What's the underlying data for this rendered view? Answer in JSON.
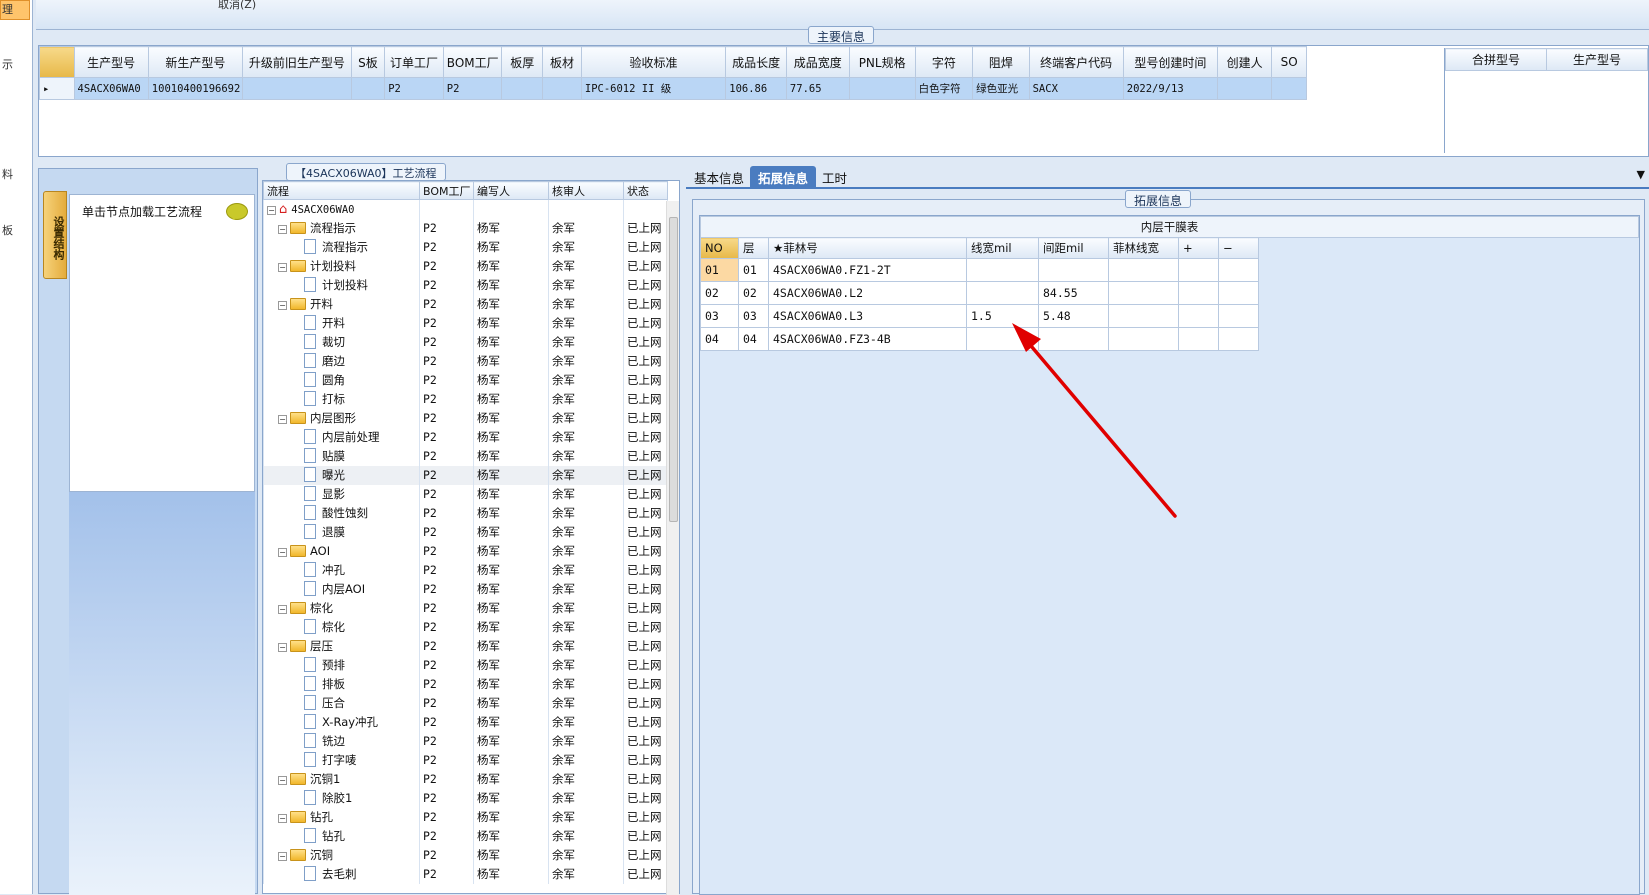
{
  "app": {
    "left_strip": {
      "items": [
        "理",
        "示",
        "料",
        "板"
      ]
    },
    "top_bar": {
      "cancel_label": "取消(Z)"
    }
  },
  "main_info": {
    "title": "主要信息",
    "columns": [
      "生产型号",
      "新生产型号",
      "升级前旧生产型号",
      "S板",
      "订单工厂",
      "BOM工厂",
      "板厚",
      "板材",
      "验收标准",
      "成品长度",
      "成品宽度",
      "PNL规格",
      "字符",
      "阻焊",
      "终端客户代码",
      "型号创建时间",
      "创建人",
      "SO"
    ],
    "row": [
      "4SACX06WA0",
      "10010400196692",
      "",
      "",
      "P2",
      "P2",
      "",
      "",
      "IPC-6012 II 级",
      "106.86",
      "77.65",
      "",
      "白色字符",
      "绿色亚光",
      "SACX",
      "2022/9/13",
      "",
      ""
    ],
    "side_columns": [
      "合拼型号",
      "生产型号"
    ]
  },
  "process_panel": {
    "title": "【4SACX06WA0】工艺流程",
    "vertical_tab": "设置结构",
    "load_hint": "单击节点加载工艺流程",
    "columns": [
      "流程",
      "BOM工厂",
      "编写人",
      "核审人",
      "状态"
    ],
    "root": "4SACX06WA0",
    "rows": [
      {
        "level": 1,
        "label": "流程指示",
        "factory": "P2",
        "writer": "杨军",
        "reviewer": "余军",
        "status": "已上网"
      },
      {
        "level": 2,
        "label": "流程指示",
        "factory": "P2",
        "writer": "杨军",
        "reviewer": "余军",
        "status": "已上网"
      },
      {
        "level": 1,
        "label": "计划投料",
        "factory": "P2",
        "writer": "杨军",
        "reviewer": "余军",
        "status": "已上网"
      },
      {
        "level": 2,
        "label": "计划投料",
        "factory": "P2",
        "writer": "杨军",
        "reviewer": "余军",
        "status": "已上网"
      },
      {
        "level": 1,
        "label": "开料",
        "factory": "P2",
        "writer": "杨军",
        "reviewer": "余军",
        "status": "已上网"
      },
      {
        "level": 2,
        "label": "开料",
        "factory": "P2",
        "writer": "杨军",
        "reviewer": "余军",
        "status": "已上网"
      },
      {
        "level": 2,
        "label": "裁切",
        "factory": "P2",
        "writer": "杨军",
        "reviewer": "余军",
        "status": "已上网"
      },
      {
        "level": 2,
        "label": "磨边",
        "factory": "P2",
        "writer": "杨军",
        "reviewer": "余军",
        "status": "已上网"
      },
      {
        "level": 2,
        "label": "圆角",
        "factory": "P2",
        "writer": "杨军",
        "reviewer": "余军",
        "status": "已上网"
      },
      {
        "level": 2,
        "label": "打标",
        "factory": "P2",
        "writer": "杨军",
        "reviewer": "余军",
        "status": "已上网"
      },
      {
        "level": 1,
        "label": "内层图形",
        "factory": "P2",
        "writer": "杨军",
        "reviewer": "余军",
        "status": "已上网"
      },
      {
        "level": 2,
        "label": "内层前处理",
        "factory": "P2",
        "writer": "杨军",
        "reviewer": "余军",
        "status": "已上网"
      },
      {
        "level": 2,
        "label": "贴膜",
        "factory": "P2",
        "writer": "杨军",
        "reviewer": "余军",
        "status": "已上网"
      },
      {
        "level": 2,
        "label": "曝光",
        "factory": "P2",
        "writer": "杨军",
        "reviewer": "余军",
        "status": "已上网",
        "highlight": true
      },
      {
        "level": 2,
        "label": "显影",
        "factory": "P2",
        "writer": "杨军",
        "reviewer": "余军",
        "status": "已上网"
      },
      {
        "level": 2,
        "label": "酸性蚀刻",
        "factory": "P2",
        "writer": "杨军",
        "reviewer": "余军",
        "status": "已上网"
      },
      {
        "level": 2,
        "label": "退膜",
        "factory": "P2",
        "writer": "杨军",
        "reviewer": "余军",
        "status": "已上网"
      },
      {
        "level": 1,
        "label": "AOI",
        "factory": "P2",
        "writer": "杨军",
        "reviewer": "余军",
        "status": "已上网"
      },
      {
        "level": 2,
        "label": "冲孔",
        "factory": "P2",
        "writer": "杨军",
        "reviewer": "余军",
        "status": "已上网"
      },
      {
        "level": 2,
        "label": "内层AOI",
        "factory": "P2",
        "writer": "杨军",
        "reviewer": "余军",
        "status": "已上网"
      },
      {
        "level": 1,
        "label": "棕化",
        "factory": "P2",
        "writer": "杨军",
        "reviewer": "余军",
        "status": "已上网"
      },
      {
        "level": 2,
        "label": "棕化",
        "factory": "P2",
        "writer": "杨军",
        "reviewer": "余军",
        "status": "已上网"
      },
      {
        "level": 1,
        "label": "层压",
        "factory": "P2",
        "writer": "杨军",
        "reviewer": "余军",
        "status": "已上网"
      },
      {
        "level": 2,
        "label": "预排",
        "factory": "P2",
        "writer": "杨军",
        "reviewer": "余军",
        "status": "已上网"
      },
      {
        "level": 2,
        "label": "排板",
        "factory": "P2",
        "writer": "杨军",
        "reviewer": "余军",
        "status": "已上网"
      },
      {
        "level": 2,
        "label": "压合",
        "factory": "P2",
        "writer": "杨军",
        "reviewer": "余军",
        "status": "已上网"
      },
      {
        "level": 2,
        "label": "X-Ray冲孔",
        "factory": "P2",
        "writer": "杨军",
        "reviewer": "余军",
        "status": "已上网"
      },
      {
        "level": 2,
        "label": "铣边",
        "factory": "P2",
        "writer": "杨军",
        "reviewer": "余军",
        "status": "已上网"
      },
      {
        "level": 2,
        "label": "打字唛",
        "factory": "P2",
        "writer": "杨军",
        "reviewer": "余军",
        "status": "已上网"
      },
      {
        "level": 1,
        "label": "沉铜1",
        "factory": "P2",
        "writer": "杨军",
        "reviewer": "余军",
        "status": "已上网"
      },
      {
        "level": 2,
        "label": "除胶1",
        "factory": "P2",
        "writer": "杨军",
        "reviewer": "余军",
        "status": "已上网"
      },
      {
        "level": 1,
        "label": "钻孔",
        "factory": "P2",
        "writer": "杨军",
        "reviewer": "余军",
        "status": "已上网"
      },
      {
        "level": 2,
        "label": "钻孔",
        "factory": "P2",
        "writer": "杨军",
        "reviewer": "余军",
        "status": "已上网"
      },
      {
        "level": 1,
        "label": "沉铜",
        "factory": "P2",
        "writer": "杨军",
        "reviewer": "余军",
        "status": "已上网"
      },
      {
        "level": 2,
        "label": "去毛刺",
        "factory": "P2",
        "writer": "杨军",
        "reviewer": "余军",
        "status": "已上网"
      }
    ]
  },
  "right_panel": {
    "tabs": [
      {
        "label": "基本信息",
        "active": false
      },
      {
        "label": "拓展信息",
        "active": true
      },
      {
        "label": "工时",
        "active": false
      }
    ],
    "group_title": "拓展信息",
    "table_title": "内层干膜表",
    "columns": [
      "NO",
      "层",
      "★菲林号",
      "线宽mil",
      "间距mil",
      "菲林线宽",
      "+",
      "−"
    ],
    "rows": [
      [
        "01",
        "01",
        "4SACX06WA0.FZ1-2T",
        "",
        "",
        "",
        "",
        ""
      ],
      [
        "02",
        "02",
        "4SACX06WA0.L2",
        "",
        "84.55",
        "",
        "",
        ""
      ],
      [
        "03",
        "03",
        "4SACX06WA0.L3",
        "1.5",
        "5.48",
        "",
        "",
        ""
      ],
      [
        "04",
        "04",
        "4SACX06WA0.FZ3-4B",
        "",
        "",
        "",
        "",
        ""
      ]
    ]
  },
  "colors": {
    "accent": "#4a7cc0",
    "selected_row": "#bad6f5",
    "arrow": "#e00000"
  }
}
